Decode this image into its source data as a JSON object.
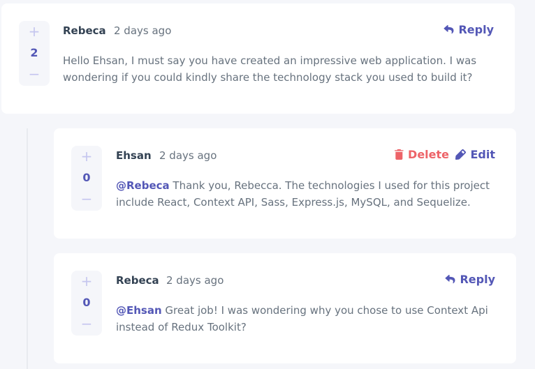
{
  "comments": [
    {
      "username": "Rebeca",
      "time": "2 days ago",
      "score": "2",
      "text": "Hello Ehsan, I must say you have created an impressive web application. I was wondering if you could kindly share the technology stack you used to build it?",
      "reply_label": "Reply"
    }
  ],
  "replies": [
    {
      "username": "Ehsan",
      "time": "2 days ago",
      "score": "0",
      "mention": "@Rebeca",
      "text": " Thank you, Rebecca. The technologies I used for this project include React, Context API, Sass, Express.js, MySQL, and Sequelize.",
      "delete_label": "Delete",
      "edit_label": "Edit"
    },
    {
      "username": "Rebeca",
      "time": "2 days ago",
      "score": "0",
      "mention": "@Ehsan",
      "text": " Great job! I was wondering why you chose to use Context Api instead of Redux Toolkit?",
      "reply_label": "Reply"
    }
  ],
  "vote": {
    "plus": "+",
    "minus": "−"
  },
  "colors": {
    "accent": "#5357b6",
    "danger": "#ed6368",
    "text": "#67727e",
    "heading": "#334253",
    "background": "#f5f6fa"
  },
  "icons": [
    "reply-icon",
    "delete-icon",
    "edit-icon"
  ]
}
